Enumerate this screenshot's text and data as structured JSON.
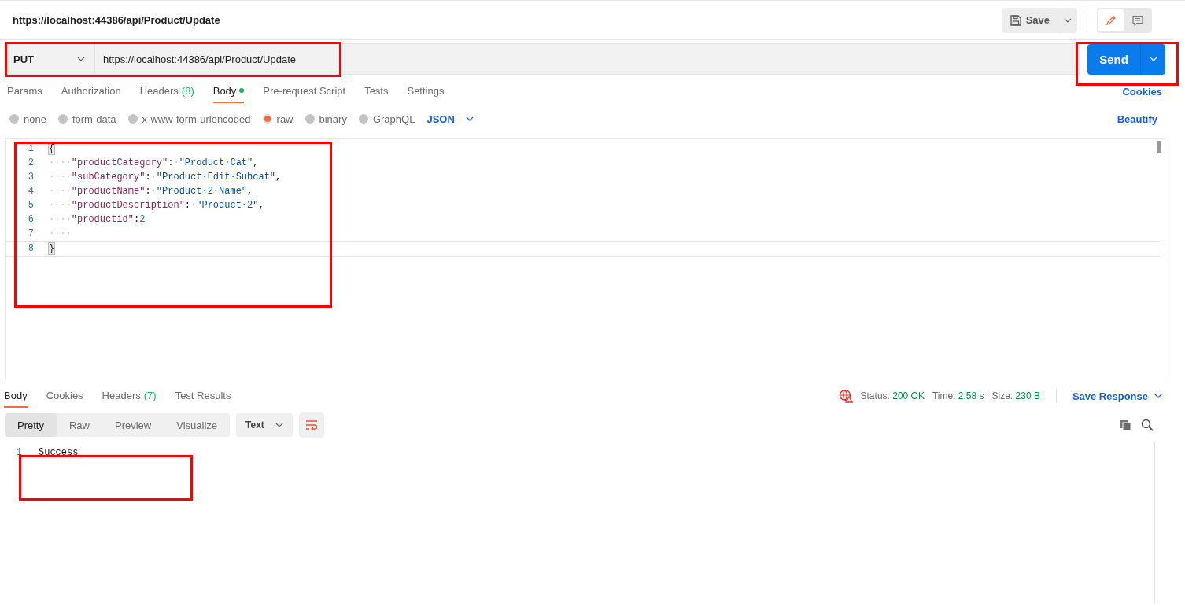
{
  "header": {
    "title": "https://localhost:44386/api/Product/Update",
    "save_label": "Save"
  },
  "request": {
    "method": "PUT",
    "url": "https://localhost:44386/api/Product/Update",
    "send_label": "Send"
  },
  "request_tabs": [
    {
      "label": "Params",
      "selected": false
    },
    {
      "label": "Authorization",
      "selected": false
    },
    {
      "label": "Headers",
      "count": "(8)",
      "selected": false
    },
    {
      "label": "Body",
      "has_content": true,
      "selected": true
    },
    {
      "label": "Pre-request Script",
      "selected": false
    },
    {
      "label": "Tests",
      "selected": false
    },
    {
      "label": "Settings",
      "selected": false
    }
  ],
  "cookies_link": "Cookies",
  "body_types": [
    {
      "label": "none",
      "selected": false
    },
    {
      "label": "form-data",
      "selected": false
    },
    {
      "label": "x-www-form-urlencoded",
      "selected": false
    },
    {
      "label": "raw",
      "selected": true
    },
    {
      "label": "binary",
      "selected": false
    },
    {
      "label": "GraphQL",
      "selected": false
    }
  ],
  "body_language": "JSON",
  "beautify_link": "Beautify",
  "editor_lines": [
    {
      "number": "1",
      "tokens": [
        {
          "kind": "bracket",
          "text": "{"
        }
      ]
    },
    {
      "number": "2",
      "tokens": [
        {
          "kind": "space",
          "text": "····"
        },
        {
          "kind": "key",
          "text": "\"productCategory\""
        },
        {
          "kind": "punct",
          "text": ":"
        },
        {
          "kind": "space",
          "text": "·"
        },
        {
          "kind": "string",
          "text": "\"Product·Cat\""
        },
        {
          "kind": "punct",
          "text": ","
        }
      ]
    },
    {
      "number": "3",
      "tokens": [
        {
          "kind": "space",
          "text": "····"
        },
        {
          "kind": "key",
          "text": "\"subCategory\""
        },
        {
          "kind": "punct",
          "text": ":"
        },
        {
          "kind": "space",
          "text": "·"
        },
        {
          "kind": "string",
          "text": "\"Product·Edit·Subcat\""
        },
        {
          "kind": "punct",
          "text": ","
        }
      ]
    },
    {
      "number": "4",
      "tokens": [
        {
          "kind": "space",
          "text": "····"
        },
        {
          "kind": "key",
          "text": "\"productName\""
        },
        {
          "kind": "punct",
          "text": ":"
        },
        {
          "kind": "space",
          "text": "·"
        },
        {
          "kind": "string",
          "text": "\"Product·2·Name\""
        },
        {
          "kind": "punct",
          "text": ","
        }
      ]
    },
    {
      "number": "5",
      "tokens": [
        {
          "kind": "space",
          "text": "····"
        },
        {
          "kind": "key",
          "text": "\"productDescription\""
        },
        {
          "kind": "punct",
          "text": ":"
        },
        {
          "kind": "space",
          "text": "·"
        },
        {
          "kind": "string",
          "text": "\"Product·2\""
        },
        {
          "kind": "punct",
          "text": ","
        }
      ]
    },
    {
      "number": "6",
      "tokens": [
        {
          "kind": "space",
          "text": "····"
        },
        {
          "kind": "key",
          "text": "\"productid\""
        },
        {
          "kind": "punct",
          "text": ":"
        },
        {
          "kind": "number",
          "text": "2"
        }
      ]
    },
    {
      "number": "7",
      "tokens": [
        {
          "kind": "space",
          "text": "····"
        }
      ]
    },
    {
      "number": "8",
      "current": true,
      "tokens": [
        {
          "kind": "bracket",
          "text": "}"
        }
      ]
    }
  ],
  "response_tabs": [
    {
      "label": "Body",
      "selected": true
    },
    {
      "label": "Cookies",
      "selected": false
    },
    {
      "label": "Headers",
      "count": "(7)",
      "selected": false
    },
    {
      "label": "Test Results",
      "selected": false
    }
  ],
  "response_meta": [
    {
      "label": "Status:",
      "value": "200 OK"
    },
    {
      "label": "Time:",
      "value": "2.58 s"
    },
    {
      "label": "Size:",
      "value": "230 B"
    }
  ],
  "save_response": "Save Response",
  "view_modes": [
    {
      "label": "Pretty",
      "selected": true
    },
    {
      "label": "Raw",
      "selected": false
    },
    {
      "label": "Preview",
      "selected": false
    },
    {
      "label": "Visualize",
      "selected": false
    }
  ],
  "format": "Text",
  "response_lines": [
    {
      "number": "1",
      "text": "Success"
    }
  ]
}
